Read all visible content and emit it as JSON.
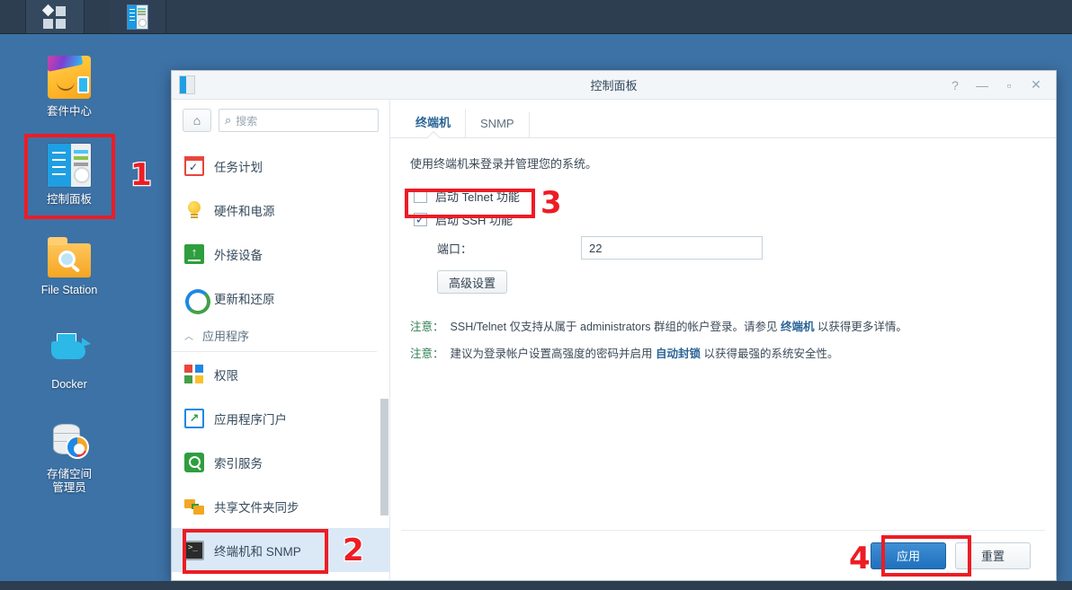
{
  "taskbar": {
    "logo_icon": "four-squares-icon",
    "app_icon": "control-panel-icon"
  },
  "desktop": {
    "background_color": "#3d72a6",
    "icons": [
      {
        "label": "套件中心",
        "icon": "package-center-icon"
      },
      {
        "label": "控制面板",
        "icon": "control-panel-icon"
      },
      {
        "label": "File Station",
        "icon": "folder-search-icon"
      },
      {
        "label": "Docker",
        "icon": "docker-whale-icon"
      },
      {
        "label": "存储空间\n管理员",
        "label_line1": "存储空间",
        "label_line2": "管理员",
        "icon": "storage-manager-icon"
      }
    ]
  },
  "annotations": {
    "accent_color": "#ed1c24",
    "steps": [
      "1",
      "2",
      "3",
      "4"
    ]
  },
  "window": {
    "title": "控制面板",
    "icon": "control-panel-icon",
    "controls": {
      "help": "?",
      "minimize": "—",
      "maximize": "▫",
      "close": "✕"
    },
    "nav": {
      "home_icon": "home-icon",
      "search": {
        "icon": "search-icon",
        "placeholder": "搜索",
        "value": ""
      },
      "items": [
        {
          "label": "任务计划",
          "icon": "task-scheduler-icon",
          "selected": false
        },
        {
          "label": "硬件和电源",
          "icon": "hardware-power-icon",
          "selected": false
        },
        {
          "label": "外接设备",
          "icon": "external-devices-icon",
          "selected": false
        },
        {
          "label": "更新和还原",
          "icon": "update-restore-icon",
          "selected": false
        }
      ],
      "group": {
        "label": "应用程序",
        "chevron_icon": "chevron-up-icon"
      },
      "items2": [
        {
          "label": "权限",
          "icon": "privileges-icon",
          "selected": false
        },
        {
          "label": "应用程序门户",
          "icon": "application-portal-icon",
          "selected": false
        },
        {
          "label": "索引服务",
          "icon": "indexing-service-icon",
          "selected": false
        },
        {
          "label": "共享文件夹同步",
          "icon": "shared-folder-sync-icon",
          "selected": false
        },
        {
          "label": "终端机和 SNMP",
          "icon": "terminal-snmp-icon",
          "selected": true
        }
      ]
    },
    "tabs": [
      {
        "label": "终端机",
        "active": true
      },
      {
        "label": "SNMP",
        "active": false
      }
    ],
    "pane": {
      "description": "使用终端机来登录并管理您的系统。",
      "telnet": {
        "label": "启动 Telnet 功能",
        "checked": false,
        "mark": ""
      },
      "ssh": {
        "label": "启动 SSH 功能",
        "checked": true,
        "mark": "✓"
      },
      "port": {
        "label": "端口：",
        "value": "22"
      },
      "advanced_button": "高级设置",
      "notes": [
        {
          "tag": "注意：",
          "pre": "SSH/Telnet 仅支持从属于 administrators 群组的帐户登录。请参见 ",
          "link": "终端机",
          "post": " 以获得更多详情。"
        },
        {
          "tag": "注意：",
          "pre": "建议为登录帐户设置高强度的密码并启用 ",
          "link": "自动封锁",
          "post": " 以获得最强的系统安全性。"
        }
      ]
    },
    "footer": {
      "apply_label": "应用",
      "reset_label": "重置",
      "primary_color": "#1f70bd"
    }
  }
}
